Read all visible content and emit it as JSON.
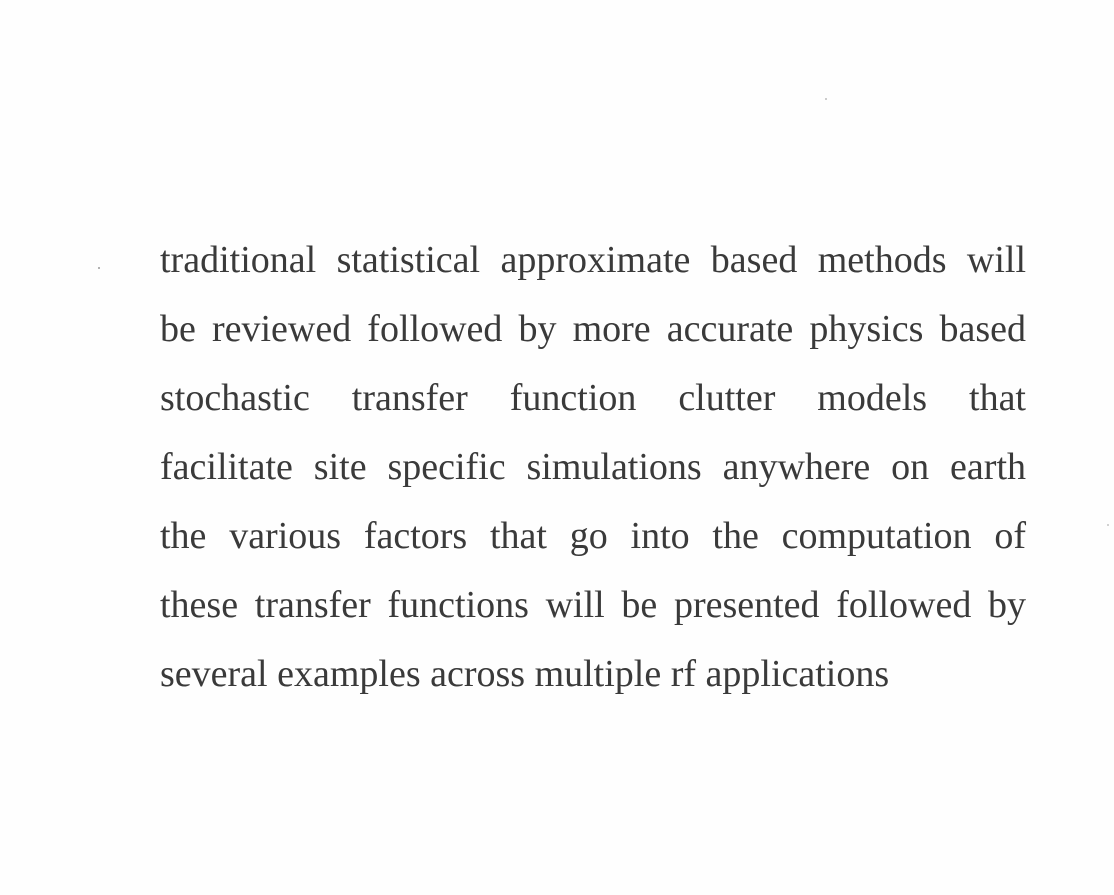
{
  "document": {
    "lines": [
      "traditional statistical approximate based methods will",
      "be reviewed followed by more accurate physics based",
      "stochastic transfer function clutter models that",
      "facilitate site specific simulations anywhere on earth",
      "the various factors that go into the computation of",
      "these transfer functions will be presented followed by",
      "several examples across multiple rf applications"
    ]
  }
}
